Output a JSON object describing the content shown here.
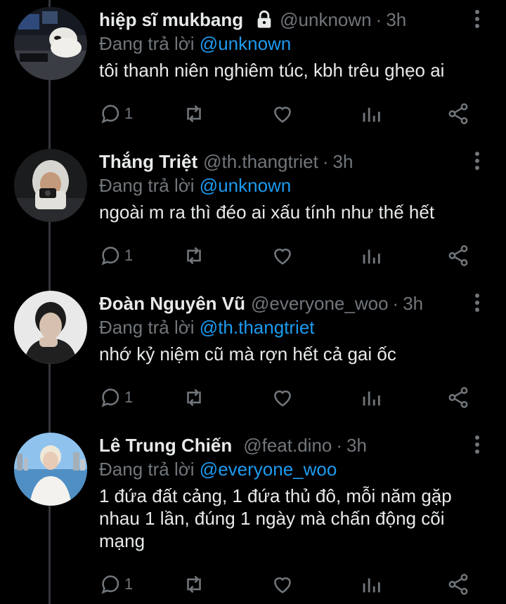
{
  "theme": {
    "background": "#000000",
    "text": "#e7e9ea",
    "muted": "#71767b",
    "accent": "#1d9bf0"
  },
  "labels": {
    "replying_to": "Đang trả lời"
  },
  "tweets": [
    {
      "name": "hiệp sĩ mukbang",
      "protected": true,
      "handle": "@unknown",
      "separator": "·",
      "time": "3h",
      "reply_to": "@unknown",
      "text": "tôi thanh niên nghiêm túc, kbh trêu ghẹo ai",
      "reply_count": "1",
      "avatar_icon": "user-photo-dog-at-computer"
    },
    {
      "name": "Thắng Triệt",
      "protected": false,
      "handle": "@th.thangtriet",
      "separator": "·",
      "time": "3h",
      "reply_to": "@unknown",
      "text": "ngoài m ra thì đéo ai xấu tính như thế hết",
      "reply_count": "1",
      "avatar_icon": "user-photo-hoodie-camera"
    },
    {
      "name": "Đoàn Nguyên Vũ",
      "protected": false,
      "handle": "@everyone_woo",
      "separator": "·",
      "time": "3h",
      "reply_to": "@th.thangtriet",
      "text": "nhớ kỷ niệm cũ mà rợn hết cả gai ốc",
      "reply_count": "1",
      "avatar_icon": "user-photo-portrait"
    },
    {
      "name": "Lê Trung Chiến",
      "protected": false,
      "handle": "@feat.dino",
      "separator": "·",
      "time": "3h",
      "reply_to": "@everyone_woo",
      "text": "1 đứa đất cảng, 1 đứa thủ đô, mỗi năm gặp nhau 1 lần, đúng 1 ngày mà chấn động cõi mạng",
      "reply_count": "1",
      "avatar_icon": "user-photo-city-background"
    }
  ]
}
